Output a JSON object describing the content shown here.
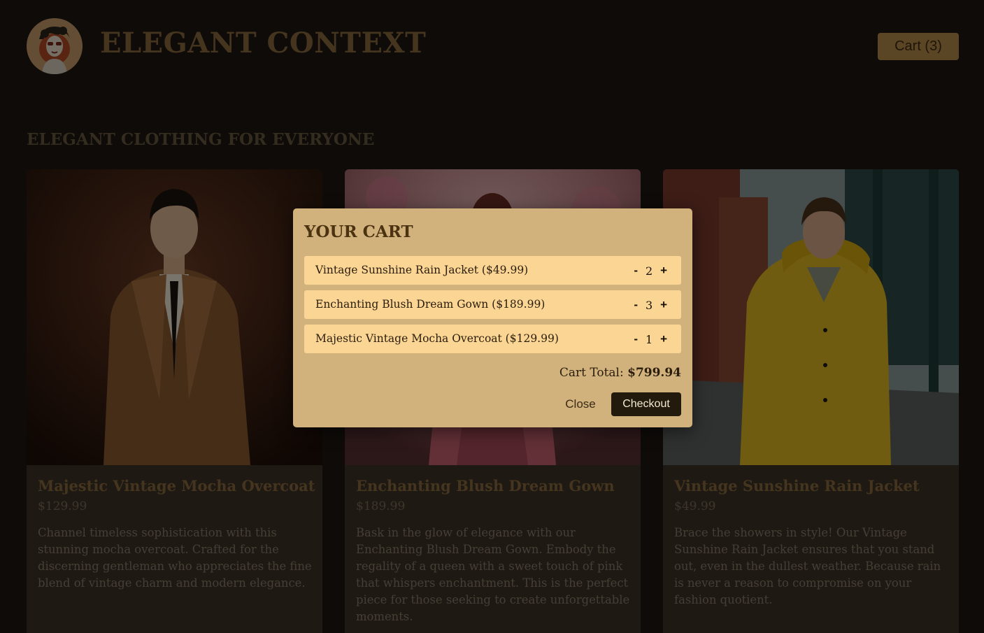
{
  "header": {
    "logo_icon": "vintage-woman-portrait-logo",
    "site_title": "ELEGANT CONTEXT",
    "cart_button_label": "Cart (3)"
  },
  "main": {
    "section_heading": "ELEGANT CLOTHING FOR EVERYONE",
    "products": [
      {
        "image_icon": "man-in-mocha-overcoat-photo",
        "title": "Majestic Vintage Mocha Overcoat",
        "price": "$129.99",
        "description": "Channel timeless sophistication with this stunning mocha overcoat. Crafted for the discerning gentleman who appreciates the fine blend of vintage charm and modern elegance."
      },
      {
        "image_icon": "woman-in-blush-gown-photo",
        "title": "Enchanting Blush Dream Gown",
        "price": "$189.99",
        "description": "Bask in the glow of elegance with our Enchanting Blush Dream Gown. Embody the regality of a queen with a sweet touch of pink that whispers enchantment. This is the perfect piece for those seeking to create unforgettable moments."
      },
      {
        "image_icon": "man-in-yellow-rain-jacket-photo",
        "title": "Vintage Sunshine Rain Jacket",
        "price": "$49.99",
        "description": "Brace the showers in style! Our Vintage Sunshine Rain Jacket ensures that you stand out, even in the dullest weather. Because rain is never a reason to compromise on your fashion quotient."
      }
    ]
  },
  "cart_modal": {
    "title": "YOUR CART",
    "items": [
      {
        "label": "Vintage Sunshine Rain Jacket ($49.99)",
        "quantity": "2",
        "decrement": "-",
        "increment": "+"
      },
      {
        "label": "Enchanting Blush Dream Gown ($189.99)",
        "quantity": "3",
        "decrement": "-",
        "increment": "+"
      },
      {
        "label": "Majestic Vintage Mocha Overcoat ($129.99)",
        "quantity": "1",
        "decrement": "-",
        "increment": "+"
      }
    ],
    "total_label": "Cart Total:",
    "total_value": "$799.94",
    "close_label": "Close",
    "checkout_label": "Checkout"
  },
  "colors": {
    "page_background": "#1c1710",
    "accent_gold": "#b48a4a",
    "modal_background": "#d2b27c",
    "cart_item_background": "#fbd593",
    "checkout_button": "#221a0d"
  }
}
